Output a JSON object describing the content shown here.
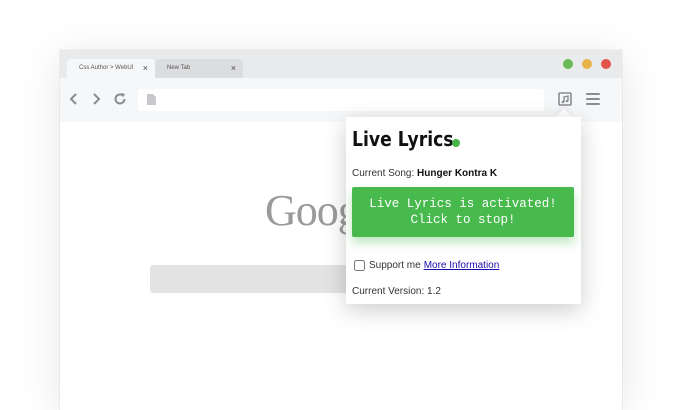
{
  "browser": {
    "tabs": [
      {
        "label": "Css Author > WebUI",
        "close": "×"
      },
      {
        "label": "New Tab",
        "close": "×"
      }
    ],
    "colors": {
      "close": "#e2554d",
      "minimize": "#e8b14a",
      "maximize": "#69b958"
    },
    "icons": [
      "back-icon",
      "forward-icon",
      "reload-icon",
      "page-icon",
      "extension-icon",
      "menu-icon"
    ]
  },
  "page": {
    "logo_text": "Goog",
    "search_value": ""
  },
  "popup": {
    "title": "Live Lyrics",
    "status_color": "#47b349",
    "song_label": "Current Song:",
    "song_name": "Hunger Kontra K",
    "button_line1": "Live Lyrics is activated!",
    "button_line2": "Click to stop!",
    "support_label": "Support me",
    "support_checked": false,
    "more_info_link": "More Information",
    "version_label": "Current Version:",
    "version_value": "1.2"
  }
}
